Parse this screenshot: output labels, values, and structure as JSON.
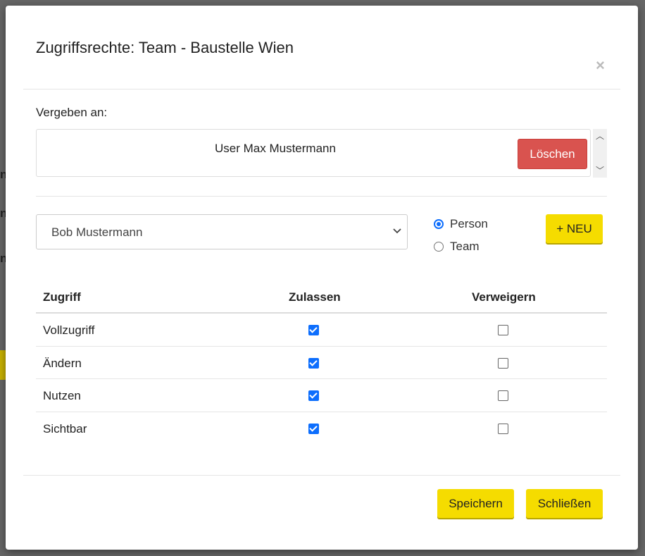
{
  "dialog": {
    "title": "Zugriffsrechte: Team - Baustelle Wien",
    "close_symbol": "×"
  },
  "assignment": {
    "label": "Vergeben an:",
    "entries": [
      {
        "name": "User Max Mustermann",
        "delete_label": "Löschen"
      }
    ]
  },
  "picker": {
    "selected_value": "Bob Mustermann",
    "radio_options": [
      {
        "label": "Person",
        "checked": true
      },
      {
        "label": "Team",
        "checked": false
      }
    ],
    "new_button_label": "+ NEU"
  },
  "permissions": {
    "headers": {
      "access": "Zugriff",
      "allow": "Zulassen",
      "deny": "Verweigern"
    },
    "rows": [
      {
        "label": "Vollzugriff",
        "allow": true,
        "deny": false
      },
      {
        "label": "Ändern",
        "allow": true,
        "deny": false
      },
      {
        "label": "Nutzen",
        "allow": true,
        "deny": false
      },
      {
        "label": "Sichtbar",
        "allow": true,
        "deny": false
      }
    ]
  },
  "footer": {
    "save_label": "Speichern",
    "close_label": "Schließen"
  },
  "colors": {
    "accent_yellow": "#f5dc00",
    "delete_red": "#d9534f",
    "checkbox_blue": "#0d6efd"
  }
}
